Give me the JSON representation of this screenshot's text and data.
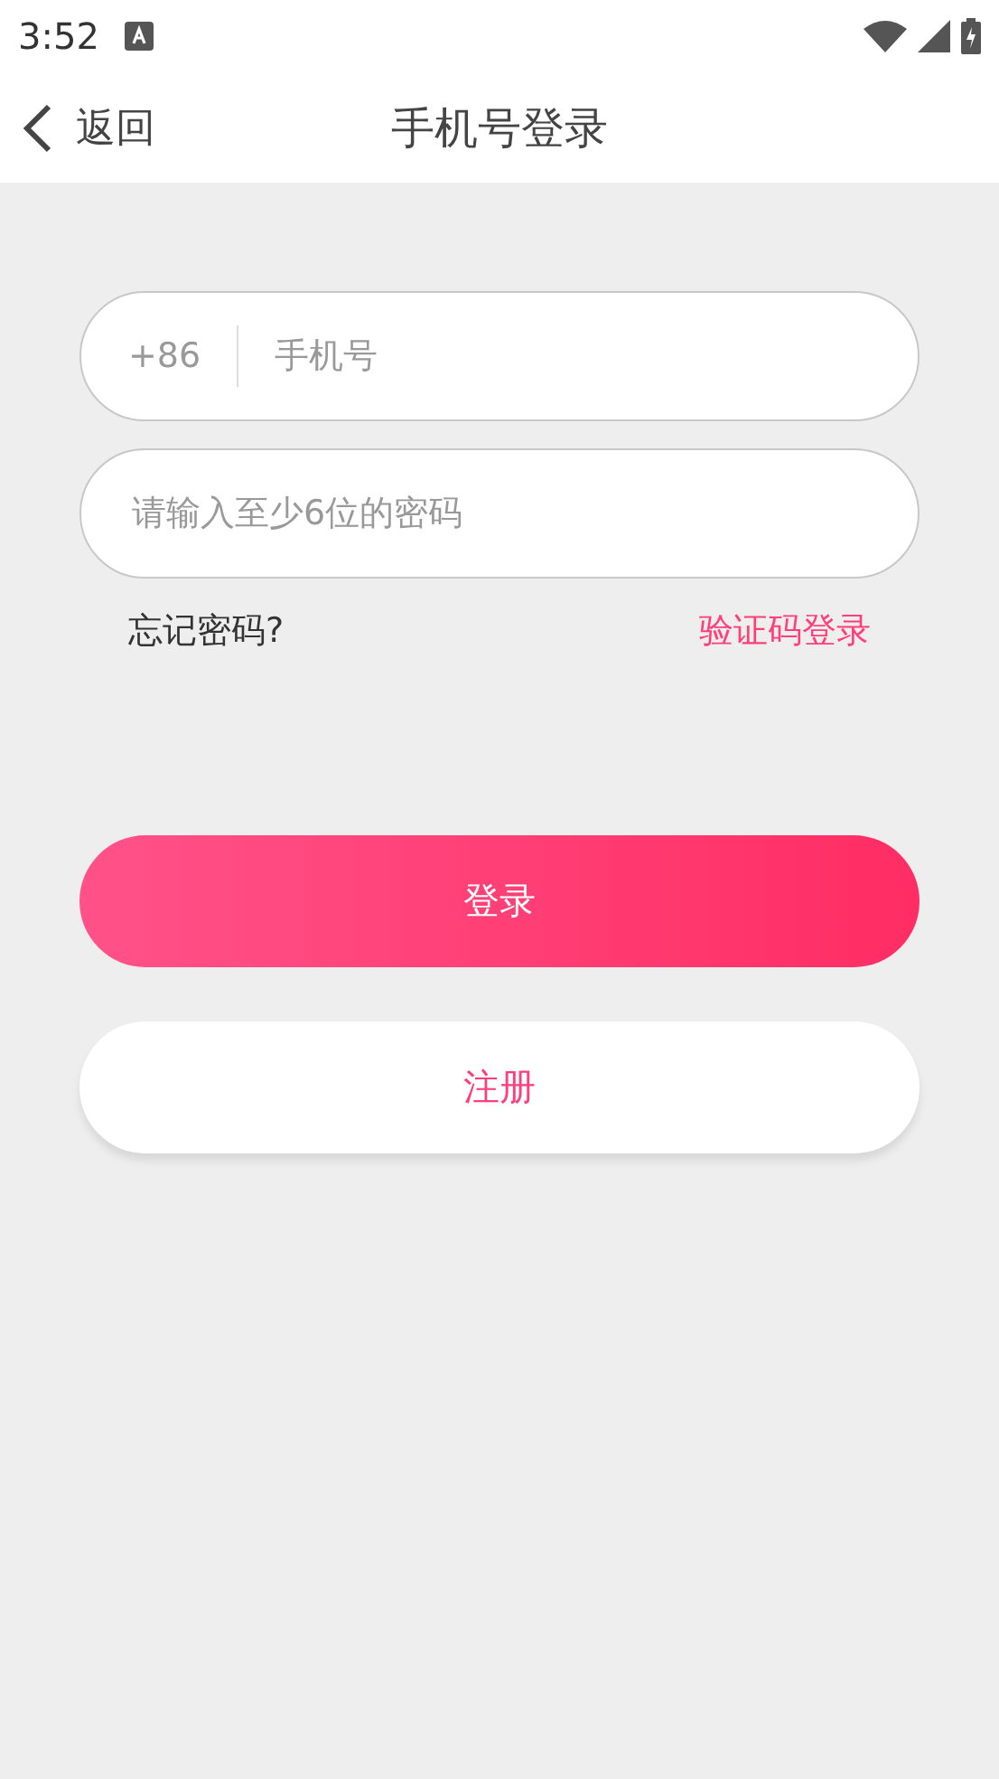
{
  "status_bar": {
    "time": "3:52"
  },
  "header": {
    "back_label": "返回",
    "title": "手机号登录"
  },
  "phone_field": {
    "country_code": "+86",
    "placeholder": "手机号"
  },
  "password_field": {
    "placeholder": "请输入至少6位的密码"
  },
  "links": {
    "forgot": "忘记密码?",
    "sms_login": "验证码登录"
  },
  "buttons": {
    "login": "登录",
    "register": "注册"
  }
}
